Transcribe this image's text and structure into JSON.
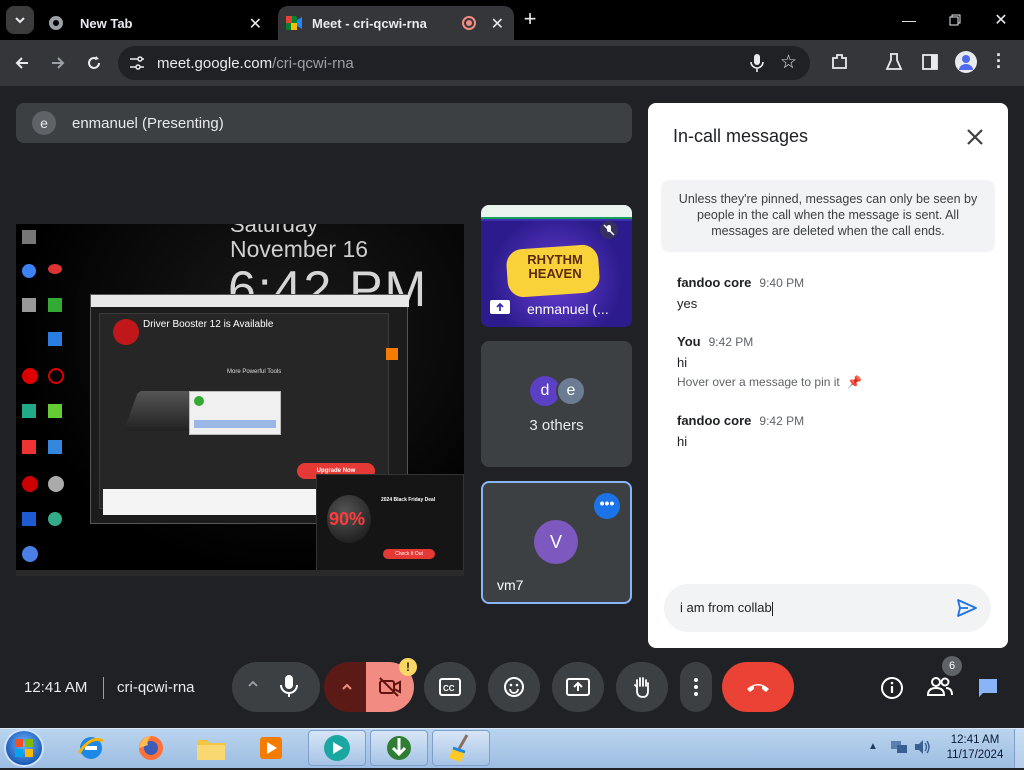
{
  "browser": {
    "tabs": [
      {
        "title": "New Tab",
        "active": false
      },
      {
        "title": "Meet - cri-qcwi-rna",
        "active": true
      }
    ],
    "url_host": "meet.google.com",
    "url_path": "/cri-qcwi-rna"
  },
  "meet": {
    "presenting": {
      "initial": "e",
      "label": "enmanuel (Presenting)"
    },
    "shared_screen": {
      "clock_day": "Saturday",
      "clock_date": "November 16",
      "clock_time": "6:42 PM",
      "popup_title": "Driver Booster 12 is Available",
      "popup_subtitle": "More Powerful Tools",
      "popup_button": "Upgrade Now",
      "ad_title": "2024 Black Friday Deal",
      "ad_badge": "90%",
      "ad_button": "Check It Out"
    },
    "tiles": [
      {
        "name": "enmanuel (...",
        "kind": "screen"
      },
      {
        "avatars": [
          "d",
          "e"
        ],
        "label": "3 others"
      },
      {
        "initial": "V",
        "name": "vm7",
        "active": true
      }
    ]
  },
  "chat": {
    "title": "In-call messages",
    "notice": "Unless they're pinned, messages can only be seen by people in the call when the message is sent. All messages are deleted when the call ends.",
    "messages": [
      {
        "sender": "fandoo core",
        "time": "9:40 PM",
        "text": "yes"
      },
      {
        "sender": "You",
        "time": "9:42 PM",
        "text": "hi",
        "hint": "Hover over a message to pin it"
      },
      {
        "sender": "fandoo core",
        "time": "9:42 PM",
        "text": "hi"
      }
    ],
    "input_value": "i am from collab"
  },
  "controls": {
    "time": "12:41 AM",
    "meeting_code": "cri-qcwi-rna",
    "people_count": "6",
    "colors": {
      "end_call": "#ea4335",
      "cam_off_bg": "#f28b82",
      "accent": "#8ab4f8"
    }
  },
  "taskbar": {
    "clock_time": "12:41 AM",
    "clock_date": "11/17/2024",
    "apps": [
      "ie-icon",
      "firefox-icon",
      "explorer-icon",
      "media-player-icon",
      "meet-app-icon",
      "idm-icon",
      "broom-icon"
    ]
  }
}
